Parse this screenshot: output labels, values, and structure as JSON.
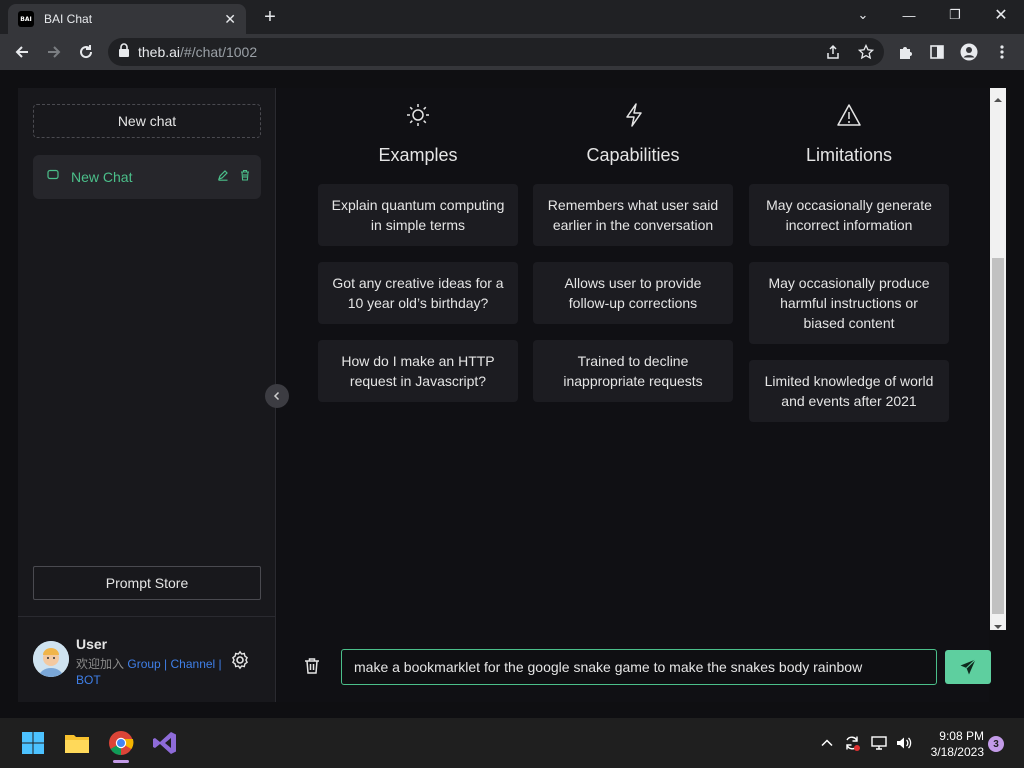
{
  "browser": {
    "tab_title": "BAI Chat",
    "favicon_text": "BAI",
    "url_host": "theb.ai",
    "url_path": "/#/chat/1002"
  },
  "sidebar": {
    "new_chat_label": "New chat",
    "chats": [
      {
        "label": "New Chat"
      }
    ],
    "prompt_store_label": "Prompt Store",
    "user": {
      "name": "User",
      "subtitle_prefix": "欢迎加入",
      "link_group": "Group",
      "sep1": " | ",
      "link_channel": "Channel",
      "sep2": " |",
      "link_bot": "BOT"
    }
  },
  "columns": [
    {
      "icon": "sun-icon",
      "title": "Examples",
      "cards": [
        "Explain quantum computing in simple terms",
        "Got any creative ideas for a 10 year old’s birthday?",
        "How do I make an HTTP request in Javascript?"
      ]
    },
    {
      "icon": "lightning-icon",
      "title": "Capabilities",
      "cards": [
        "Remembers what user said earlier in the conversation",
        "Allows user to provide follow-up corrections",
        "Trained to decline inappropriate requests"
      ]
    },
    {
      "icon": "warning-icon",
      "title": "Limitations",
      "cards": [
        "May occasionally generate incorrect information",
        "May occasionally produce harmful instructions or biased content",
        "Limited knowledge of world and events after 2021"
      ]
    }
  ],
  "composer": {
    "value": "make a bookmarklet for the google snake game to make the snakes body rainbow"
  },
  "taskbar": {
    "time": "9:08 PM",
    "date": "3/18/2023",
    "notification_count": "3"
  },
  "colors": {
    "accent": "#4bbf8a",
    "send_button": "#5ecf9f",
    "link": "#3f7fe8"
  }
}
